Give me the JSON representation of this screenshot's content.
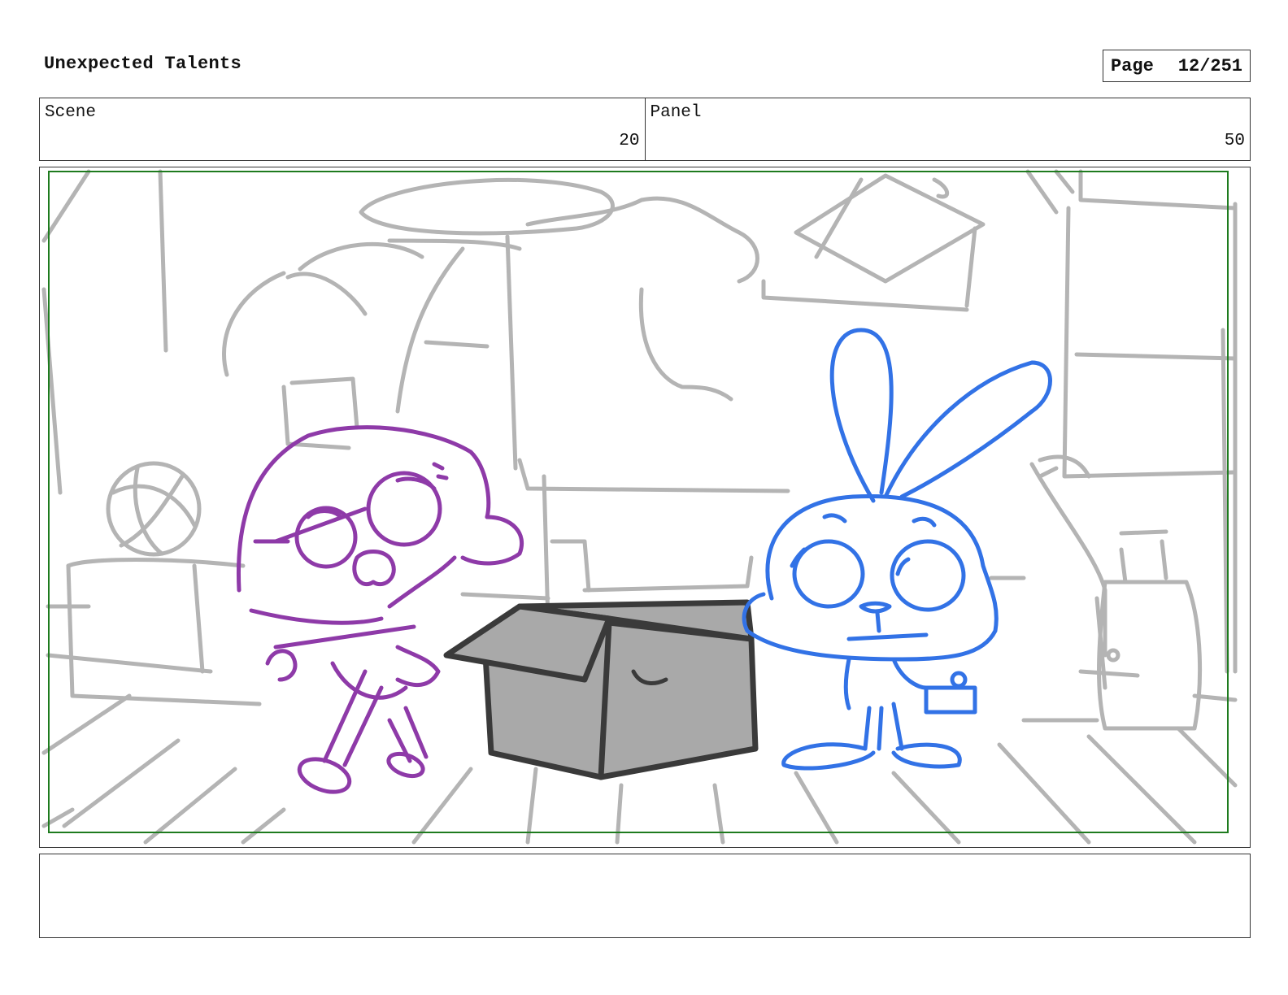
{
  "header": {
    "title": "Unexpected Talents",
    "page_label": "Page",
    "page_value": "12/251"
  },
  "info": {
    "scene_label": "Scene",
    "scene_value": "20",
    "panel_label": "Panel",
    "panel_value": "50"
  },
  "colors": {
    "safe_frame": "#1e7b1e",
    "background_sketch": "#b4b4b4",
    "girl_character": "#8e3aa8",
    "bunny_character": "#3272e6",
    "box_fill": "#a9a9a9",
    "box_outline": "#3a3a3a"
  },
  "notes": {
    "text": ""
  }
}
